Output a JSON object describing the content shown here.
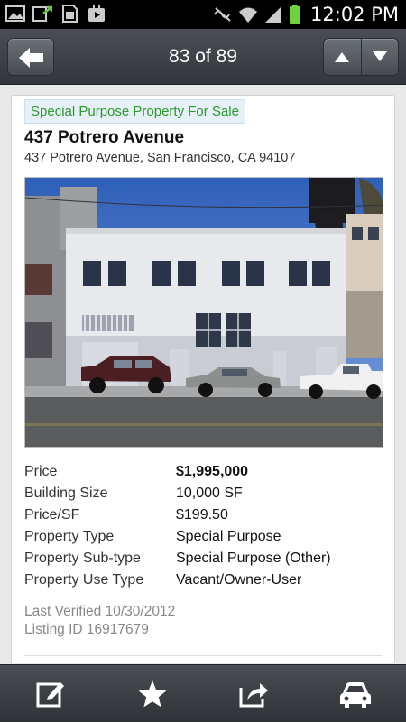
{
  "status_bar": {
    "time": "12:02 PM",
    "icons": [
      "gallery-icon",
      "upload-icon",
      "sd-card-icon",
      "play-store-icon",
      "mute-icon",
      "wifi-icon",
      "signal-icon",
      "battery-icon"
    ]
  },
  "nav": {
    "position_label": "83 of 89",
    "back_icon": "back-arrow-icon",
    "prev_icon": "arrow-up-icon",
    "next_icon": "arrow-down-icon"
  },
  "listing": {
    "category": "Special Purpose Property For Sale",
    "title": "437 Potrero Avenue",
    "address": "437 Potrero Avenue, San Francisco, CA 94107",
    "details": [
      {
        "label": "Price",
        "value": "$1,995,000"
      },
      {
        "label": "Building Size",
        "value": "10,000 SF"
      },
      {
        "label": "Price/SF",
        "value": "$199.50"
      },
      {
        "label": "Property Type",
        "value": "Special Purpose"
      },
      {
        "label": "Property Sub-type",
        "value": "Special Purpose (Other)"
      },
      {
        "label": "Property Use Type",
        "value": "Vacant/Owner-User"
      }
    ],
    "last_verified": "Last Verified 10/30/2012",
    "listing_id": "Listing ID 16917679"
  },
  "toolbar": {
    "icons": [
      "edit-note-icon",
      "star-icon",
      "share-icon",
      "car-icon"
    ]
  },
  "colors": {
    "badge_text": "#2a9a2a",
    "badge_bg": "#e6f0f7",
    "bar_bg": "#3a3d42"
  }
}
